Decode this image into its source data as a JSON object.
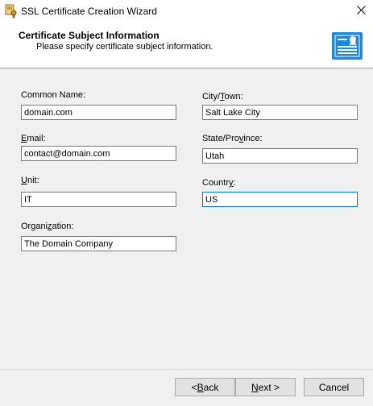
{
  "window": {
    "title": "SSL Certificate Creation Wizard"
  },
  "header": {
    "title": "Certificate Subject Information",
    "subtitle": "Please specify certificate subject information."
  },
  "form": {
    "common_name": {
      "label": "Common Name:",
      "value": "domain.com"
    },
    "email": {
      "label_prefix": "",
      "label_accel": "E",
      "label_rest": "mail:",
      "value": "contact@domain.com"
    },
    "unit": {
      "label_accel": "U",
      "label_rest": "nit:",
      "value": "IT"
    },
    "organization": {
      "label_prefix": "Organi",
      "label_accel": "z",
      "label_rest": "ation:",
      "value": "The Domain Company"
    },
    "city": {
      "label_prefix": "City/",
      "label_accel": "T",
      "label_rest": "own:",
      "value": "Salt Lake City"
    },
    "state": {
      "label_prefix": "State/Pro",
      "label_accel": "v",
      "label_rest": "ince:",
      "value": "Utah"
    },
    "country": {
      "label_prefix": "Countr",
      "label_accel": "y",
      "label_rest": ":",
      "value": "US"
    }
  },
  "buttons": {
    "back_prefix": "< ",
    "back_accel": "B",
    "back_rest": "ack",
    "next_accel": "N",
    "next_rest": "ext >",
    "cancel": "Cancel"
  },
  "colors": {
    "accent": "#0078d7",
    "header_icon": "#1e88d8"
  }
}
